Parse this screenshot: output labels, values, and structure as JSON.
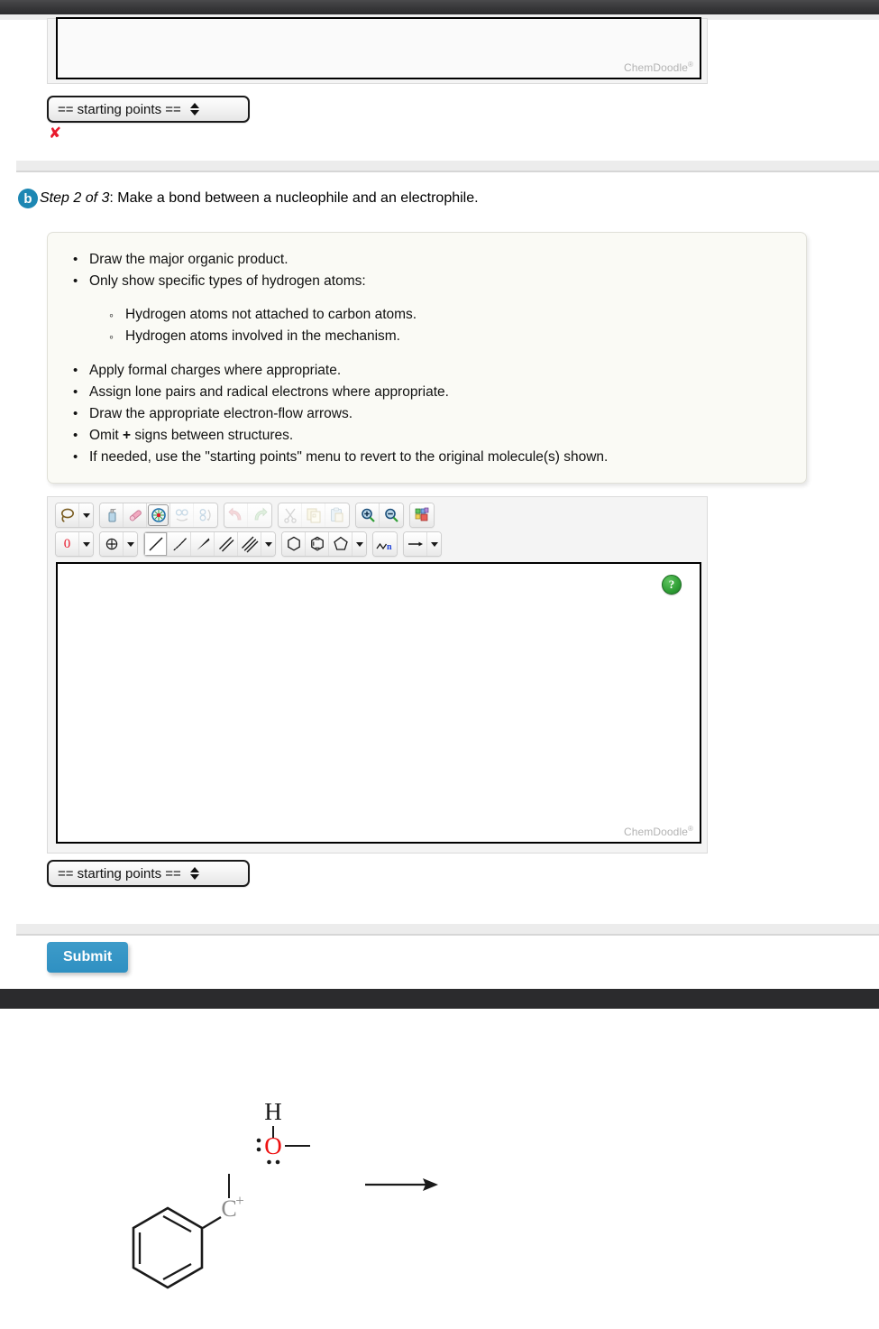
{
  "page": {
    "watermark": "ChemDoodle",
    "watermark_sup": "®"
  },
  "top_sketcher": {
    "starting_points_label": "== starting points ==",
    "result_mark": "✘",
    "watermark": "ChemDoodle"
  },
  "step": {
    "badge": "b",
    "prefix": "Step 2 of 3",
    "suffix": ": Make a bond between a nucleophile and an electrophile."
  },
  "instructions": {
    "items": [
      "Draw the major organic product.",
      "Only show specific types of hydrogen atoms:"
    ],
    "sub_items": [
      "Hydrogen atoms not attached to carbon atoms.",
      "Hydrogen atoms involved in the mechanism."
    ],
    "items2": [
      "Apply formal charges where appropriate.",
      "Assign lone pairs and radical electrons where appropriate.",
      "Draw the appropriate electron-flow arrows."
    ],
    "omit_prefix": "Omit ",
    "omit_plus": "+",
    "omit_suffix": " signs between structures.",
    "last_item": "If needed, use the \"starting points\" menu to revert to the original molecule(s) shown."
  },
  "toolbar": {
    "row1": [
      {
        "name": "lasso-select-tool",
        "title": "Lasso select"
      },
      {
        "name": "lasso-dropdown-arrow",
        "title": "Select options"
      },
      {
        "name": "clear-tool",
        "title": "Clear"
      },
      {
        "name": "eraser-tool",
        "title": "Eraser"
      },
      {
        "name": "clean-structure-tool",
        "title": "Clean structure"
      },
      {
        "name": "flip-horizontal-tool",
        "title": "Flip horizontal"
      },
      {
        "name": "flip-vertical-tool",
        "title": "Flip vertical"
      },
      {
        "name": "undo-tool",
        "title": "Undo"
      },
      {
        "name": "redo-tool",
        "title": "Redo"
      },
      {
        "name": "cut-tool",
        "title": "Cut"
      },
      {
        "name": "copy-tool",
        "title": "Copy"
      },
      {
        "name": "paste-tool",
        "title": "Paste"
      },
      {
        "name": "zoom-in-tool",
        "title": "Zoom in"
      },
      {
        "name": "zoom-out-tool",
        "title": "Zoom out"
      },
      {
        "name": "periodic-table-tool",
        "title": "Periodic table"
      }
    ],
    "charge_label": "0",
    "chain_label": "n",
    "row2": [
      {
        "name": "charge-tool",
        "title": "Charge"
      },
      {
        "name": "charge-dropdown-arrow",
        "title": "Charge options"
      },
      {
        "name": "lone-pair-tool",
        "title": "Lone pair / radical"
      },
      {
        "name": "lone-pair-dropdown-arrow",
        "title": "Lone pair options"
      },
      {
        "name": "single-bond-tool",
        "title": "Single bond"
      },
      {
        "name": "hash-bond-tool",
        "title": "Hashed wedge bond"
      },
      {
        "name": "wedge-bond-tool",
        "title": "Wedge bond"
      },
      {
        "name": "double-bond-tool",
        "title": "Double bond"
      },
      {
        "name": "triple-bond-tool",
        "title": "Triple bond"
      },
      {
        "name": "bond-dropdown-arrow",
        "title": "Bond options"
      },
      {
        "name": "cyclohexane-tool",
        "title": "Cyclohexane ring"
      },
      {
        "name": "benzene-tool",
        "title": "Benzene ring"
      },
      {
        "name": "cyclopentane-tool",
        "title": "Cyclopentane ring"
      },
      {
        "name": "ring-dropdown-arrow",
        "title": "Ring options"
      },
      {
        "name": "chain-tool",
        "title": "Chain"
      },
      {
        "name": "reaction-arrow-tool",
        "title": "Reaction arrow"
      },
      {
        "name": "arrow-dropdown-arrow",
        "title": "Arrow options"
      }
    ]
  },
  "sketcher": {
    "help_label": "?",
    "starting_points_label": "== starting points ==",
    "watermark": "ChemDoodle"
  },
  "molecule": {
    "hydrogen_label": "H",
    "oxygen_label": "O",
    "carbon_label": "C",
    "carbon_charge": "+",
    "lone_pair_left": ":",
    "lone_pair_below": "..",
    "oxygen_color": "#ee1111",
    "carbon_color": "#8c8c8c",
    "ring": "benzene"
  },
  "footer": {
    "submit_label": "Submit"
  },
  "colors": {
    "accent_blue": "#2f90c2",
    "badge_blue": "#1d87b3",
    "error_red": "#e8192c",
    "help_green": "#2f9e35",
    "chrome_dark": "#2c2c2e"
  }
}
